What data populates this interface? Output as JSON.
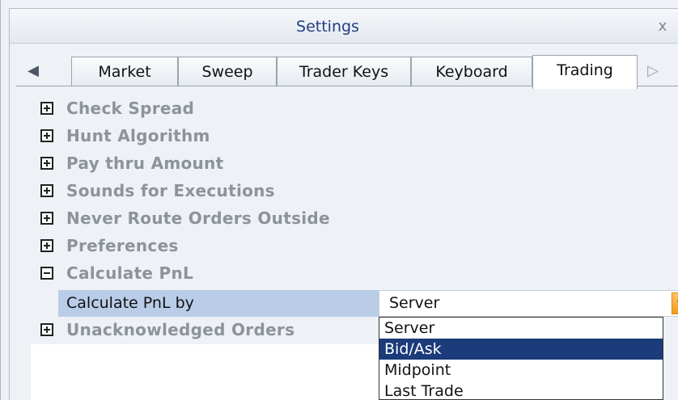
{
  "window": {
    "title": "Settings",
    "close_glyph": "x"
  },
  "tabs": {
    "left_arrow": "◀",
    "right_arrow": "▷",
    "items": [
      {
        "label": "Market"
      },
      {
        "label": "Sweep"
      },
      {
        "label": "Trader Keys"
      },
      {
        "label": "Keyboard"
      },
      {
        "label": "Trading",
        "active": true
      }
    ]
  },
  "tree": {
    "items": [
      {
        "label": "Check Spread",
        "state": "collapsed"
      },
      {
        "label": "Hunt Algorithm",
        "state": "collapsed"
      },
      {
        "label": "Pay thru Amount",
        "state": "collapsed"
      },
      {
        "label": "Sounds for Executions",
        "state": "collapsed"
      },
      {
        "label": "Never Route Orders Outside",
        "state": "collapsed"
      },
      {
        "label": "Preferences",
        "state": "collapsed"
      },
      {
        "label": "Calculate PnL",
        "state": "expanded"
      },
      {
        "label": "Unacknowledged Orders",
        "state": "collapsed"
      }
    ]
  },
  "pnl_setting": {
    "label": "Calculate PnL by",
    "value": "Server",
    "options": [
      "Server",
      "Bid/Ask",
      "Midpoint",
      "Last Trade"
    ],
    "highlighted_option": "Bid/Ask"
  },
  "colors": {
    "title_text": "#1f3d84",
    "row_highlight": "#b9cde8",
    "dropdown_selected": "#1b3b7a",
    "dropdown_arrow": "#f29a1b"
  }
}
